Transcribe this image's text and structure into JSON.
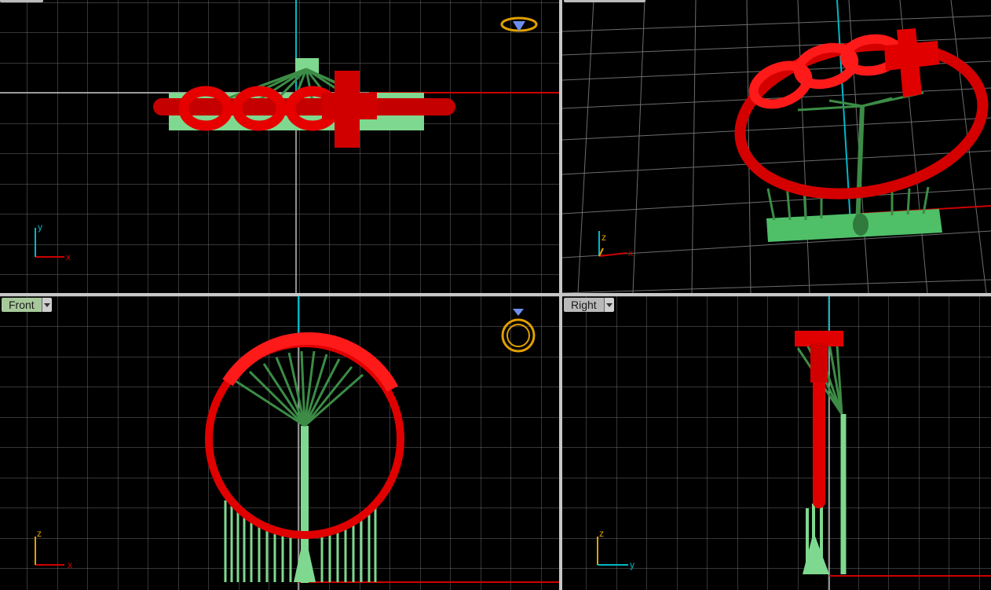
{
  "viewports": {
    "top": {
      "axis_h": "x",
      "axis_v": "y"
    },
    "perspective": {
      "axis_h": "x",
      "axis_v": "z"
    },
    "front": {
      "label": "Front",
      "axis_h": "x",
      "axis_v": "z"
    },
    "right": {
      "label": "Right",
      "axis_h": "y",
      "axis_v": "z"
    }
  },
  "colors": {
    "model": "#e00000",
    "supports": "#3c8c46",
    "base": "#7fd88f",
    "grid": "#7a7a7a",
    "axis_x": "#cc0000",
    "axis_y": "#00b8c8",
    "gizmo": "#e0a000"
  }
}
